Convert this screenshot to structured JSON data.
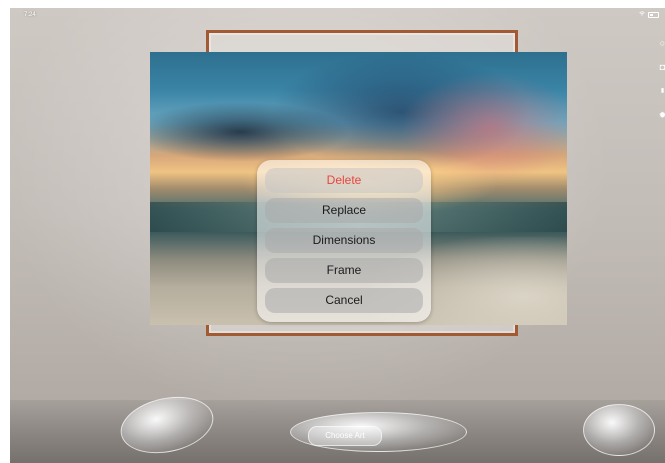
{
  "status_bar": {
    "time": "7:24",
    "icons": [
      "wifi-icon",
      "battery-icon"
    ]
  },
  "side_toolbar": {
    "icons": [
      "circle-icon",
      "camera-icon",
      "record-icon",
      "gear-icon"
    ]
  },
  "scene": {
    "frame_color": "#a25a32"
  },
  "action_sheet": {
    "delete_label": "Delete",
    "replace_label": "Replace",
    "dimensions_label": "Dimensions",
    "frame_label": "Frame",
    "cancel_label": "Cancel",
    "delete_color": "#e8463f"
  },
  "bottom_bar": {
    "choose_art_label": "Choose Art"
  }
}
